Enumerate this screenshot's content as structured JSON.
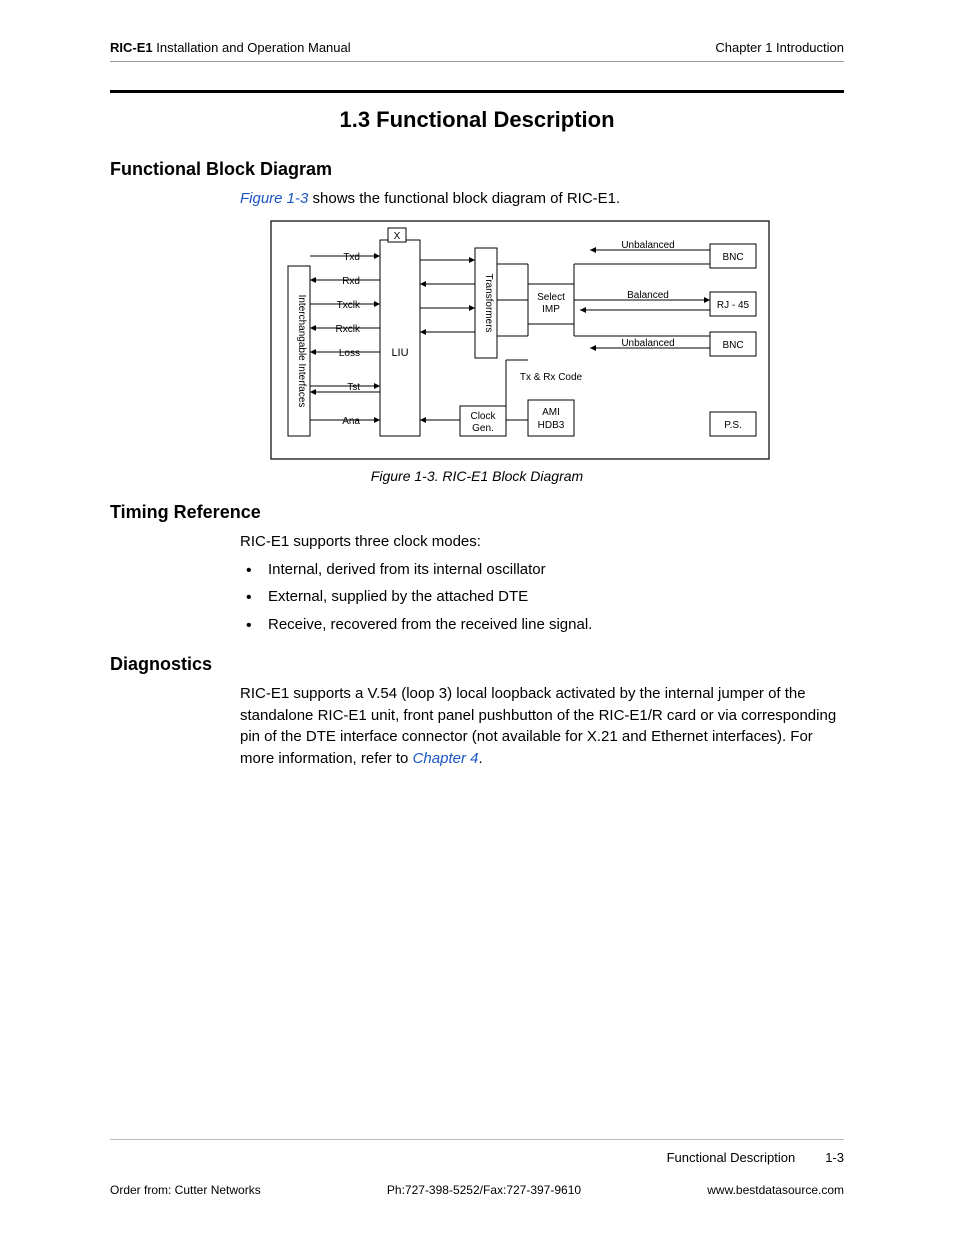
{
  "header": {
    "manual_name_bold": "RIC-E1",
    "manual_name_rest": " Installation and Operation Manual",
    "chapter": "Chapter 1  Introduction"
  },
  "section": {
    "number_title": "1.3  Functional Description"
  },
  "fbd": {
    "heading": "Functional Block Diagram",
    "intro_before": " shows the functional block diagram of RIC-E1.",
    "figref": "Figure 1-3",
    "caption": "Figure 1-3.  RIC-E1 Block Diagram"
  },
  "diagram": {
    "interfaces": "Interchangable Interfaces",
    "signals": [
      "Txd",
      "Rxd",
      "Txclk",
      "Rxclk",
      "Loss",
      "Tst",
      "Ana"
    ],
    "liu": "LIU",
    "x": "X",
    "transformers": "Transformers",
    "clockgen_l1": "Clock",
    "clockgen_l2": "Gen.",
    "select_l1": "Select",
    "select_l2": "IMP",
    "txrx": "Tx & Rx Code",
    "ami": "AMI",
    "hdb3": "HDB3",
    "unbalanced": "Unbalanced",
    "balanced": "Balanced",
    "bnc": "BNC",
    "rj45": "RJ - 45",
    "ps": "P.S."
  },
  "timing": {
    "heading": "Timing Reference",
    "intro": "RIC-E1 supports three clock modes:",
    "items": [
      "Internal, derived from its internal oscillator",
      "External, supplied by the attached DTE",
      "Receive, recovered from the received line signal."
    ]
  },
  "diag": {
    "heading": "Diagnostics",
    "body_before": "RIC-E1 supports a V.54 (loop 3) local loopback activated by the internal jumper of the standalone RIC-E1 unit, front panel pushbutton of the RIC-E1/R card or via corresponding pin of the DTE interface connector (not available for X.21 and Ethernet interfaces). For more information, refer to ",
    "chapref": "Chapter 4",
    "body_after": "."
  },
  "footer": {
    "section_name": "Functional Description",
    "page": "1-3",
    "order": "Order from: Cutter Networks",
    "phone": "Ph:727-398-5252/Fax:727-397-9610",
    "web": "www.bestdatasource.com"
  }
}
